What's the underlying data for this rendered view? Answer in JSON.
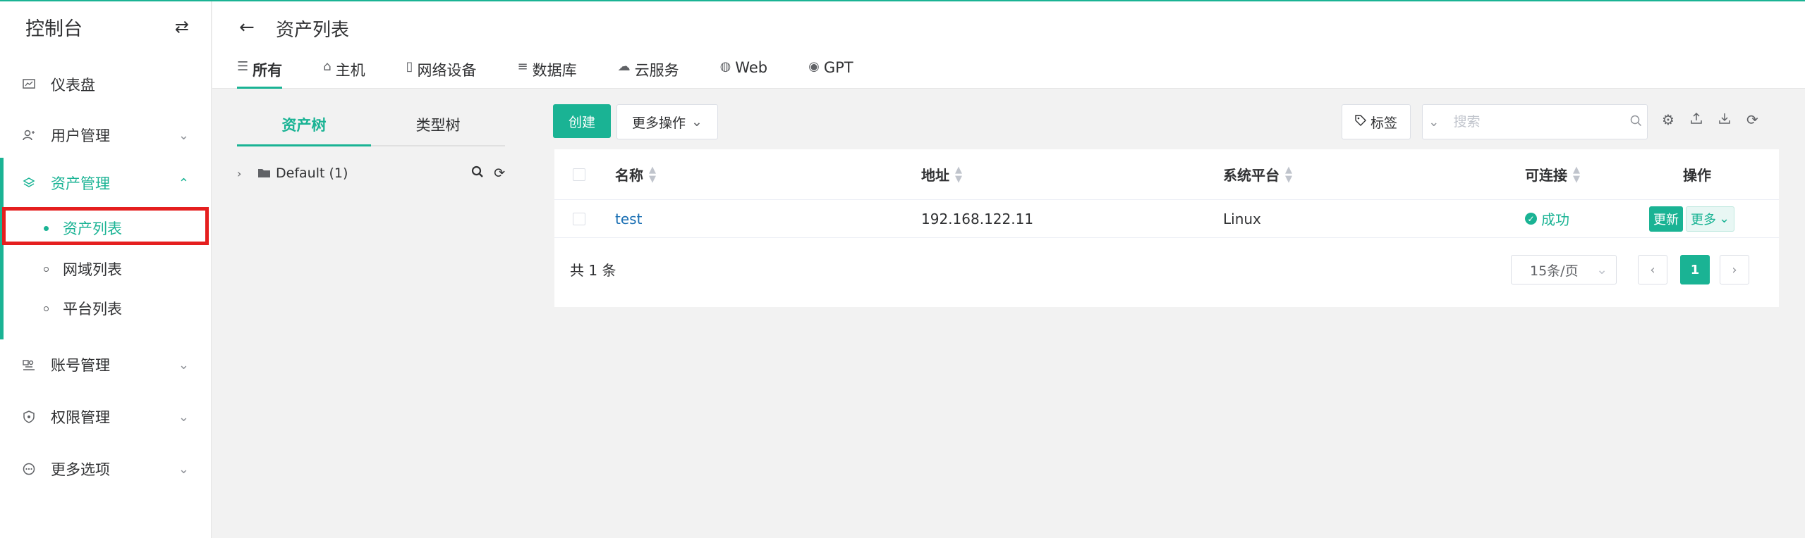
{
  "sidebar": {
    "title": "控制台",
    "toggle_icon": "swap-icon",
    "menu": [
      {
        "label": "仪表盘",
        "icon": "dashboard-icon"
      },
      {
        "label": "用户管理",
        "icon": "users-icon"
      },
      {
        "label": "资产管理",
        "icon": "layers-icon"
      },
      {
        "label": "账号管理",
        "icon": "accounts-icon"
      },
      {
        "label": "权限管理",
        "icon": "shield-icon"
      },
      {
        "label": "更多选项",
        "icon": "more-circle-icon"
      }
    ],
    "asset_submenu": [
      {
        "label": "资产列表",
        "active": true
      },
      {
        "label": "网域列表",
        "active": false
      },
      {
        "label": "平台列表",
        "active": false
      }
    ]
  },
  "header": {
    "title": "资产列表",
    "tabs": [
      {
        "label": "所有",
        "icon": "list-icon",
        "glyph": "☰"
      },
      {
        "label": "主机",
        "icon": "host-icon",
        "glyph": "⌂"
      },
      {
        "label": "网络设备",
        "icon": "device-icon",
        "glyph": "▯"
      },
      {
        "label": "数据库",
        "icon": "database-icon",
        "glyph": "≡"
      },
      {
        "label": "云服务",
        "icon": "cloud-icon",
        "glyph": "☁"
      },
      {
        "label": "Web",
        "icon": "globe-icon",
        "glyph": "◍"
      },
      {
        "label": "GPT",
        "icon": "chat-icon",
        "glyph": "◉"
      }
    ]
  },
  "tree": {
    "tabs": [
      "资产树",
      "类型树"
    ],
    "root_node": "Default (1)"
  },
  "toolbar": {
    "create_label": "创建",
    "more_actions_label": "更多操作",
    "tag_label": "标签",
    "search_placeholder": "搜索"
  },
  "table": {
    "columns": [
      "名称",
      "地址",
      "系统平台",
      "可连接",
      "操作"
    ],
    "rows": [
      {
        "name": "test",
        "address": "192.168.122.11",
        "platform": "Linux",
        "connectivity": "成功",
        "update_label": "更新",
        "more_label": "更多"
      }
    ],
    "total_text": "共 1 条",
    "page_size": "15条/页",
    "current_page": "1"
  },
  "colors": {
    "accent": "#1ab394",
    "highlight": "#e51f1f",
    "link": "#1a6fb3"
  }
}
